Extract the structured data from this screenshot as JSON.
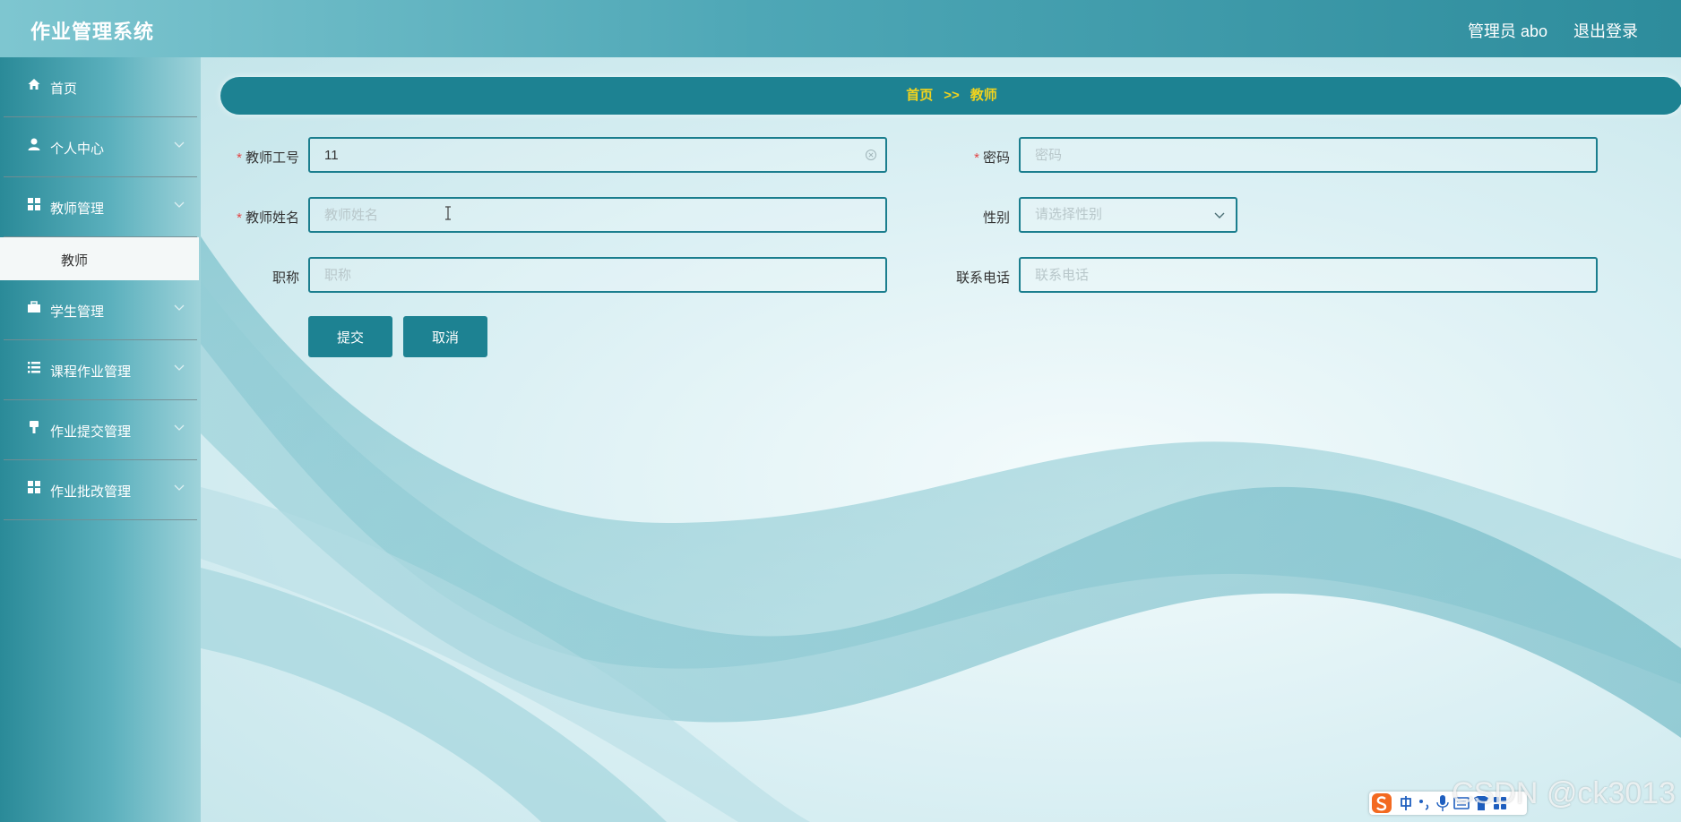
{
  "header": {
    "app_title": "作业管理系统",
    "user_label": "管理员 abo",
    "logout_label": "退出登录"
  },
  "sidebar": {
    "items": [
      {
        "label": "首页",
        "icon": "home-icon",
        "has_chevron": false
      },
      {
        "label": "个人中心",
        "icon": "user-icon",
        "has_chevron": true
      },
      {
        "label": "教师管理",
        "icon": "grid-icon",
        "has_chevron": true
      },
      {
        "label": "学生管理",
        "icon": "briefcase-icon",
        "has_chevron": true
      },
      {
        "label": "课程作业管理",
        "icon": "list-icon",
        "has_chevron": true
      },
      {
        "label": "作业提交管理",
        "icon": "brush-icon",
        "has_chevron": true
      },
      {
        "label": "作业批改管理",
        "icon": "grid-icon",
        "has_chevron": true
      }
    ],
    "active_sub_item": {
      "label": "教师"
    }
  },
  "breadcrumb": {
    "home": "首页",
    "separator": ">>",
    "current": "教师"
  },
  "form": {
    "teacher_id": {
      "label": "教师工号",
      "required": true,
      "value": "11",
      "placeholder": ""
    },
    "password": {
      "label": "密码",
      "required": true,
      "value": "",
      "placeholder": "密码"
    },
    "teacher_name": {
      "label": "教师姓名",
      "required": true,
      "value": "",
      "placeholder": "教师姓名"
    },
    "gender": {
      "label": "性别",
      "required": false,
      "placeholder": "请选择性别"
    },
    "title": {
      "label": "职称",
      "required": false,
      "value": "",
      "placeholder": "职称"
    },
    "phone": {
      "label": "联系电话",
      "required": false,
      "value": "",
      "placeholder": "联系电话"
    },
    "submit_label": "提交",
    "cancel_label": "取消",
    "required_mark": "*"
  },
  "overlay": {
    "watermark": "CSDN @ck3013"
  },
  "colors": {
    "accent": "#1d8292",
    "breadcrumb_text": "#f2d31d",
    "required": "#e24545"
  }
}
